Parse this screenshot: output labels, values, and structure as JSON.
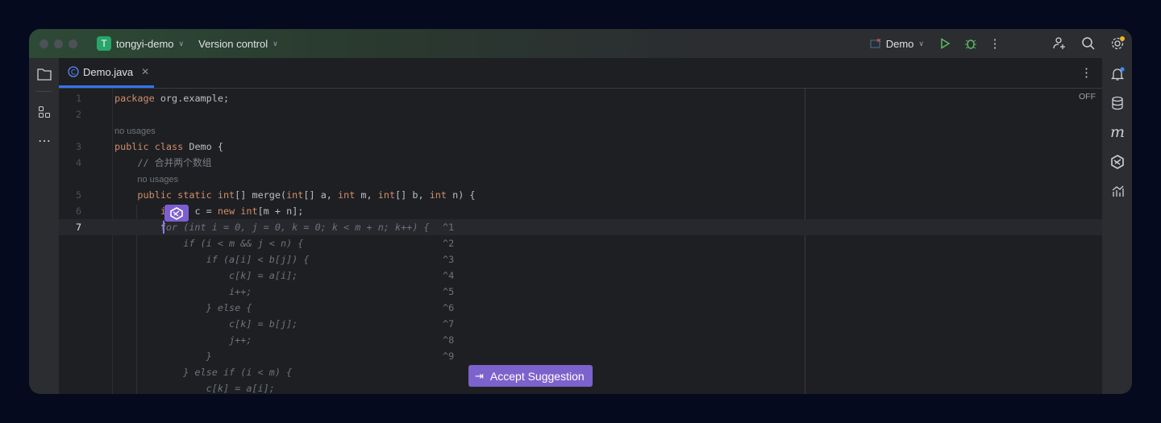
{
  "titlebar": {
    "project_initial": "T",
    "project": "tongyi-demo",
    "vcs": "Version control",
    "run_config": "Demo"
  },
  "tab": {
    "label": "Demo.java"
  },
  "editor": {
    "off_label": "OFF",
    "rows": [
      {
        "ln": "1",
        "tokens": [
          [
            "kw",
            "package "
          ],
          [
            "pl",
            "org.example;"
          ]
        ]
      },
      {
        "ln": "2",
        "tokens": []
      },
      {
        "ln": "",
        "usage": "no usages",
        "indent": 0
      },
      {
        "ln": "3",
        "tokens": [
          [
            "kw",
            "public class "
          ],
          [
            "pl",
            "Demo {"
          ]
        ]
      },
      {
        "ln": "4",
        "tokens": [
          [
            "cm",
            "    // 合并两个数组"
          ]
        ]
      },
      {
        "ln": "",
        "usage": "no usages",
        "indent": 4
      },
      {
        "ln": "5",
        "tokens": [
          [
            "kw",
            "    public static int"
          ],
          [
            "pl",
            "[] merge("
          ],
          [
            "kw",
            "int"
          ],
          [
            "pl",
            "[] a, "
          ],
          [
            "kw",
            "int"
          ],
          [
            "pl",
            " m, "
          ],
          [
            "kw",
            "int"
          ],
          [
            "pl",
            "[] b, "
          ],
          [
            "kw",
            "int"
          ],
          [
            "pl",
            " n) {"
          ]
        ]
      },
      {
        "ln": "6",
        "tokens": [
          [
            "kw",
            "        int"
          ],
          [
            "pl",
            "[] c = "
          ],
          [
            "kw",
            "new int"
          ],
          [
            "pl",
            "[m + n];"
          ]
        ]
      },
      {
        "ln": "7",
        "current": true,
        "tokens": [
          [
            "pl",
            "        f"
          ],
          [
            "ghost",
            "or (int i = 0, j = 0, k = 0; k < m + n; k++) {"
          ]
        ],
        "hint": "^1"
      },
      {
        "ln": "",
        "tokens": [
          [
            "ghost",
            "            if (i < m && j < n) {"
          ]
        ],
        "hint": "^2"
      },
      {
        "ln": "",
        "tokens": [
          [
            "ghost",
            "                if (a[i] < b[j]) {"
          ]
        ],
        "hint": "^3"
      },
      {
        "ln": "",
        "tokens": [
          [
            "ghost",
            "                    c[k] = a[i];"
          ]
        ],
        "hint": "^4"
      },
      {
        "ln": "",
        "tokens": [
          [
            "ghost",
            "                    i++;"
          ]
        ],
        "hint": "^5"
      },
      {
        "ln": "",
        "tokens": [
          [
            "ghost",
            "                } else {"
          ]
        ],
        "hint": "^6"
      },
      {
        "ln": "",
        "tokens": [
          [
            "ghost",
            "                    c[k] = b[j];"
          ]
        ],
        "hint": "^7"
      },
      {
        "ln": "",
        "tokens": [
          [
            "ghost",
            "                    j++;"
          ]
        ],
        "hint": "^8"
      },
      {
        "ln": "",
        "tokens": [
          [
            "ghost",
            "                }"
          ]
        ],
        "hint": "^9"
      },
      {
        "ln": "",
        "tokens": [
          [
            "ghost",
            "            } else if (i < m) {"
          ]
        ]
      },
      {
        "ln": "",
        "tokens": [
          [
            "ghost",
            "                c[k] = a[i];"
          ]
        ]
      }
    ]
  },
  "accept_button": {
    "label": "Accept Suggestion"
  },
  "colors": {
    "accent": "#3574f0",
    "ai": "#7b5fd1",
    "run": "#5fb865",
    "keyword": "#cf8e6d"
  }
}
